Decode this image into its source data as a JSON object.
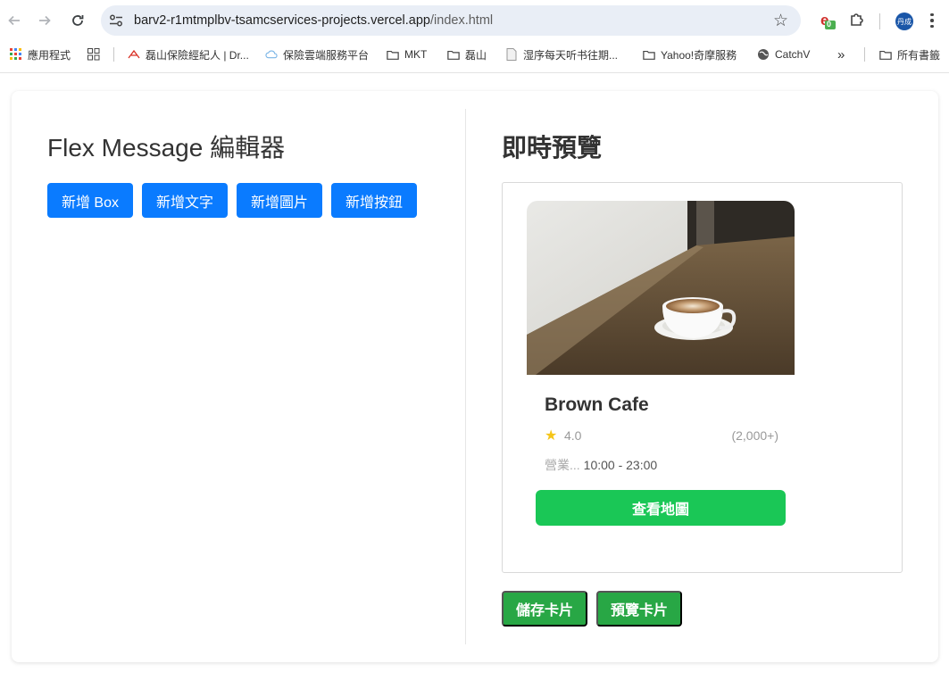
{
  "browser": {
    "url_host": "barv2-r1mtmplbv-tsamcservices-projects.vercel.app",
    "url_path": "/index.html",
    "extension_badge": "0",
    "profile_label": "丹成"
  },
  "bookmarks": {
    "items": [
      {
        "label": "應用程式",
        "icon": "apps-grid-icon"
      },
      {
        "label": "",
        "icon": "tab-groups-icon"
      },
      {
        "label": "磊山保險經紀人 | Dr...",
        "icon": "pdf-icon"
      },
      {
        "label": "保險雲端服務平台",
        "icon": "cloud-icon"
      },
      {
        "label": "MKT",
        "icon": "folder-icon"
      },
      {
        "label": "磊山",
        "icon": "folder-icon"
      },
      {
        "label": "湿序每天听书往期...",
        "icon": "page-icon"
      },
      {
        "label": "Yahoo!奇摩服務",
        "icon": "folder-icon"
      },
      {
        "label": "CatchV",
        "icon": "globe-icon"
      }
    ],
    "overflow_label": "»",
    "all_bookmarks_label": "所有書籤"
  },
  "editor": {
    "title": "Flex Message 編輯器",
    "buttons": [
      "新增 Box",
      "新增文字",
      "新增圖片",
      "新增按鈕"
    ]
  },
  "preview": {
    "title": "即時預覽",
    "card": {
      "name": "Brown Cafe",
      "rating": "4.0",
      "rating_icon": "star-icon",
      "reviews": "(2,000+)",
      "hours_label": "營業...",
      "hours_value": "10:00 - 23:00",
      "action_label": "查看地圖"
    }
  },
  "actions": {
    "save_label": "儲存卡片",
    "preview_label": "預覽卡片"
  },
  "colors": {
    "primary_blue": "#0a7bff",
    "line_green": "#1ac756",
    "save_green": "#28a745",
    "star_gold": "#f5c518"
  }
}
